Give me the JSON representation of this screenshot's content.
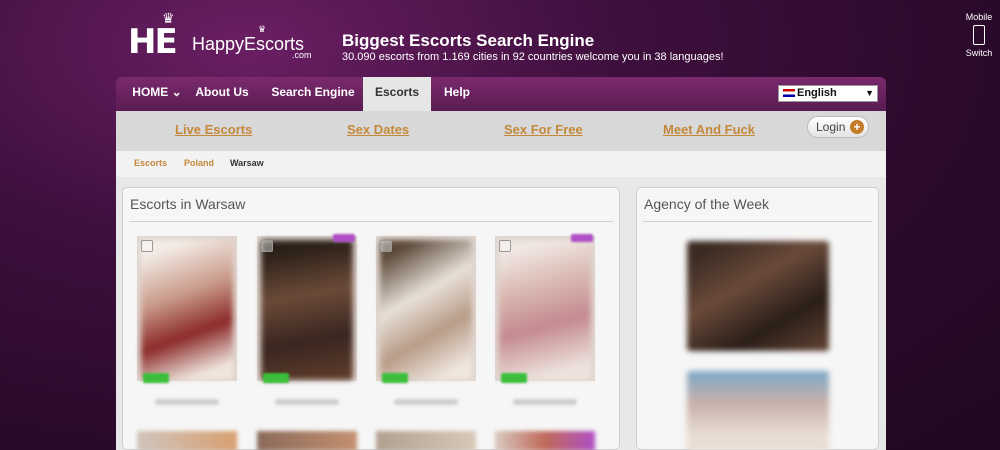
{
  "header": {
    "logo_mark": "HE",
    "logo_name": "HappyEscorts",
    "logo_tld": ".com",
    "title": "Biggest Escorts Search Engine",
    "subtitle": "30.090 escorts from 1.169 cities in 92 countries welcome you in 38 languages!",
    "mobile_label": "Mobile",
    "switch_label": "Switch"
  },
  "nav": {
    "items": [
      {
        "label": "HOME ⌄"
      },
      {
        "label": "About Us"
      },
      {
        "label": "Search Engine"
      },
      {
        "label": "Escorts"
      },
      {
        "label": "Help"
      }
    ],
    "active": "Escorts",
    "language": "English"
  },
  "subnav": {
    "links": [
      "Live Escorts",
      "Sex Dates",
      "Sex For Free",
      "Meet And Fuck"
    ],
    "login_label": "Login"
  },
  "breadcrumb": [
    "Escorts",
    "Poland",
    "Warsaw"
  ],
  "main": {
    "title": "Escorts in Warsaw"
  },
  "sidebar": {
    "title": "Agency of the Week"
  },
  "colors": {
    "accent": "#c4883b",
    "nav_bg": "#6a2360",
    "background": "#3e0f3d"
  }
}
